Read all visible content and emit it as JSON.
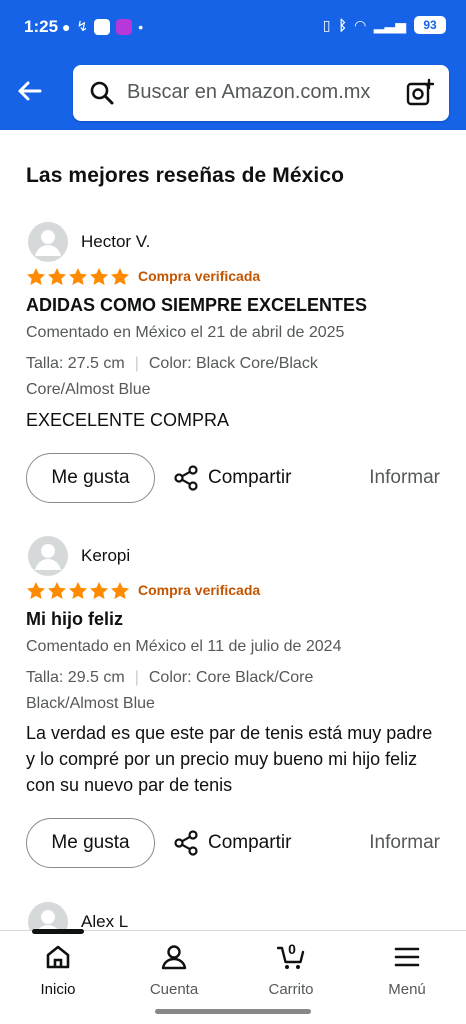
{
  "status_bar": {
    "time": "1:25",
    "battery": "93"
  },
  "search": {
    "placeholder": "Buscar en Amazon.com.mx"
  },
  "section_title": "Las mejores reseñas de México",
  "reviews": [
    {
      "reviewer": "Hector V.",
      "rating": 5,
      "verified": "Compra verificada",
      "title": "ADIDAS COMO SIEMPRE EXCELENTES",
      "date": "Comentado en México el 21 de abril de 2025",
      "size": "Talla: 27.5 cm",
      "color": "Color: Black Core/Black Core/Almost Blue",
      "body": "EXECELENTE COMPRA"
    },
    {
      "reviewer": "Keropi",
      "rating": 5,
      "verified": "Compra verificada",
      "title": "Mi hijo feliz",
      "date": "Comentado en México el 11 de julio de 2024",
      "size": "Talla: 29.5 cm",
      "color": "Color: Core Black/Core Black/Almost Blue",
      "body": "La verdad es que este par de tenis está muy padre y lo compré por un precio muy bueno mi hijo feliz con su nuevo par de tenis"
    },
    {
      "reviewer": "Alex L"
    }
  ],
  "actions": {
    "like": "Me gusta",
    "share": "Compartir",
    "report": "Informar"
  },
  "bottom_nav": [
    {
      "label": "Inicio",
      "icon": "home-icon"
    },
    {
      "label": "Cuenta",
      "icon": "user-icon"
    },
    {
      "label": "Carrito",
      "icon": "cart-icon",
      "count": "0"
    },
    {
      "label": "Menú",
      "icon": "menu-icon"
    }
  ],
  "colors": {
    "header": "#1663e8",
    "star": "#ff8a00",
    "verified": "#c45500"
  }
}
